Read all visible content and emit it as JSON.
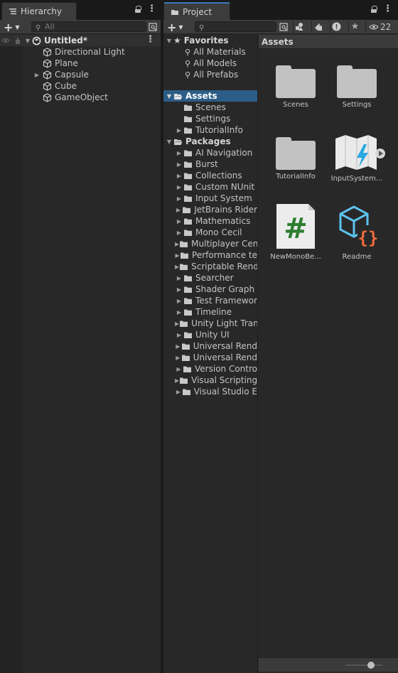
{
  "hierarchy": {
    "tab_label": "Hierarchy",
    "search_placeholder": "All",
    "scene_name": "Untitled*",
    "items": [
      {
        "label": "Directional Light",
        "expandable": false
      },
      {
        "label": "Plane",
        "expandable": false
      },
      {
        "label": "Capsule",
        "expandable": true
      },
      {
        "label": "Cube",
        "expandable": false
      },
      {
        "label": "GameObject",
        "expandable": false
      }
    ]
  },
  "project": {
    "tab_label": "Project",
    "hidden_count": "22",
    "favorites": {
      "label": "Favorites",
      "items": [
        "All Materials",
        "All Models",
        "All Prefabs"
      ]
    },
    "assets": {
      "label": "Assets",
      "children": [
        {
          "label": "Scenes",
          "expandable": false
        },
        {
          "label": "Settings",
          "expandable": false
        },
        {
          "label": "TutorialInfo",
          "expandable": true
        }
      ]
    },
    "packages": {
      "label": "Packages",
      "children": [
        "AI Navigation",
        "Burst",
        "Collections",
        "Custom NUnit",
        "Input System",
        "JetBrains Rider",
        "Mathematics",
        "Mono Cecil",
        "Multiplayer Cen",
        "Performance te",
        "Scriptable Rend",
        "Searcher",
        "Shader Graph",
        "Test Framewor",
        "Timeline",
        "Unity Light Tran",
        "Unity UI",
        "Universal Rend",
        "Universal Rend",
        "Version Contro",
        "Visual Scripting",
        "Visual Studio E"
      ]
    },
    "grid_header": "Assets",
    "grid_items": [
      {
        "label": "Scenes",
        "icon": "folder-icon"
      },
      {
        "label": "Settings",
        "icon": "folder-icon"
      },
      {
        "label": "TutorialInfo",
        "icon": "folder-icon"
      },
      {
        "label": "InputSystem...",
        "icon": "input-actions-icon"
      },
      {
        "label": "NewMonoBe...",
        "icon": "csharp-script-icon"
      },
      {
        "label": "Readme",
        "icon": "readme-icon"
      }
    ]
  },
  "colors": {
    "selection": "#2c5d87",
    "accent_blue": "#3a79bb",
    "folder": "#c2c2c2"
  }
}
